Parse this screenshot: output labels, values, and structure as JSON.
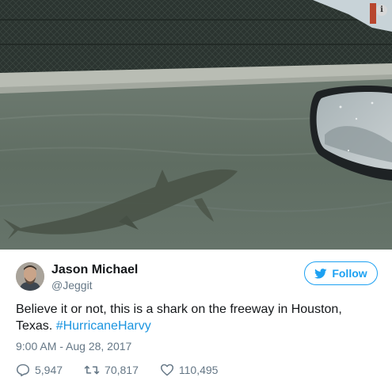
{
  "author": {
    "name": "Jason Michael",
    "handle": "@Jeggit"
  },
  "follow_button": {
    "label": "Follow",
    "icon": "twitter-bird-icon",
    "color": "#1da1f2"
  },
  "tweet": {
    "text_prefix": "Believe it or not, this is a shark on the freeway in Houston, Texas. ",
    "hashtag": "#HurricaneHarvy",
    "hashtag_color": "#1b95e0",
    "timestamp": "9:00 AM - Aug 28, 2017"
  },
  "media": {
    "info_label": "i"
  },
  "actions": {
    "replies": "5,947",
    "retweets": "70,817",
    "likes": "110,495",
    "reply_icon": "reply-icon",
    "retweet_icon": "retweet-icon",
    "like_icon": "heart-icon"
  }
}
